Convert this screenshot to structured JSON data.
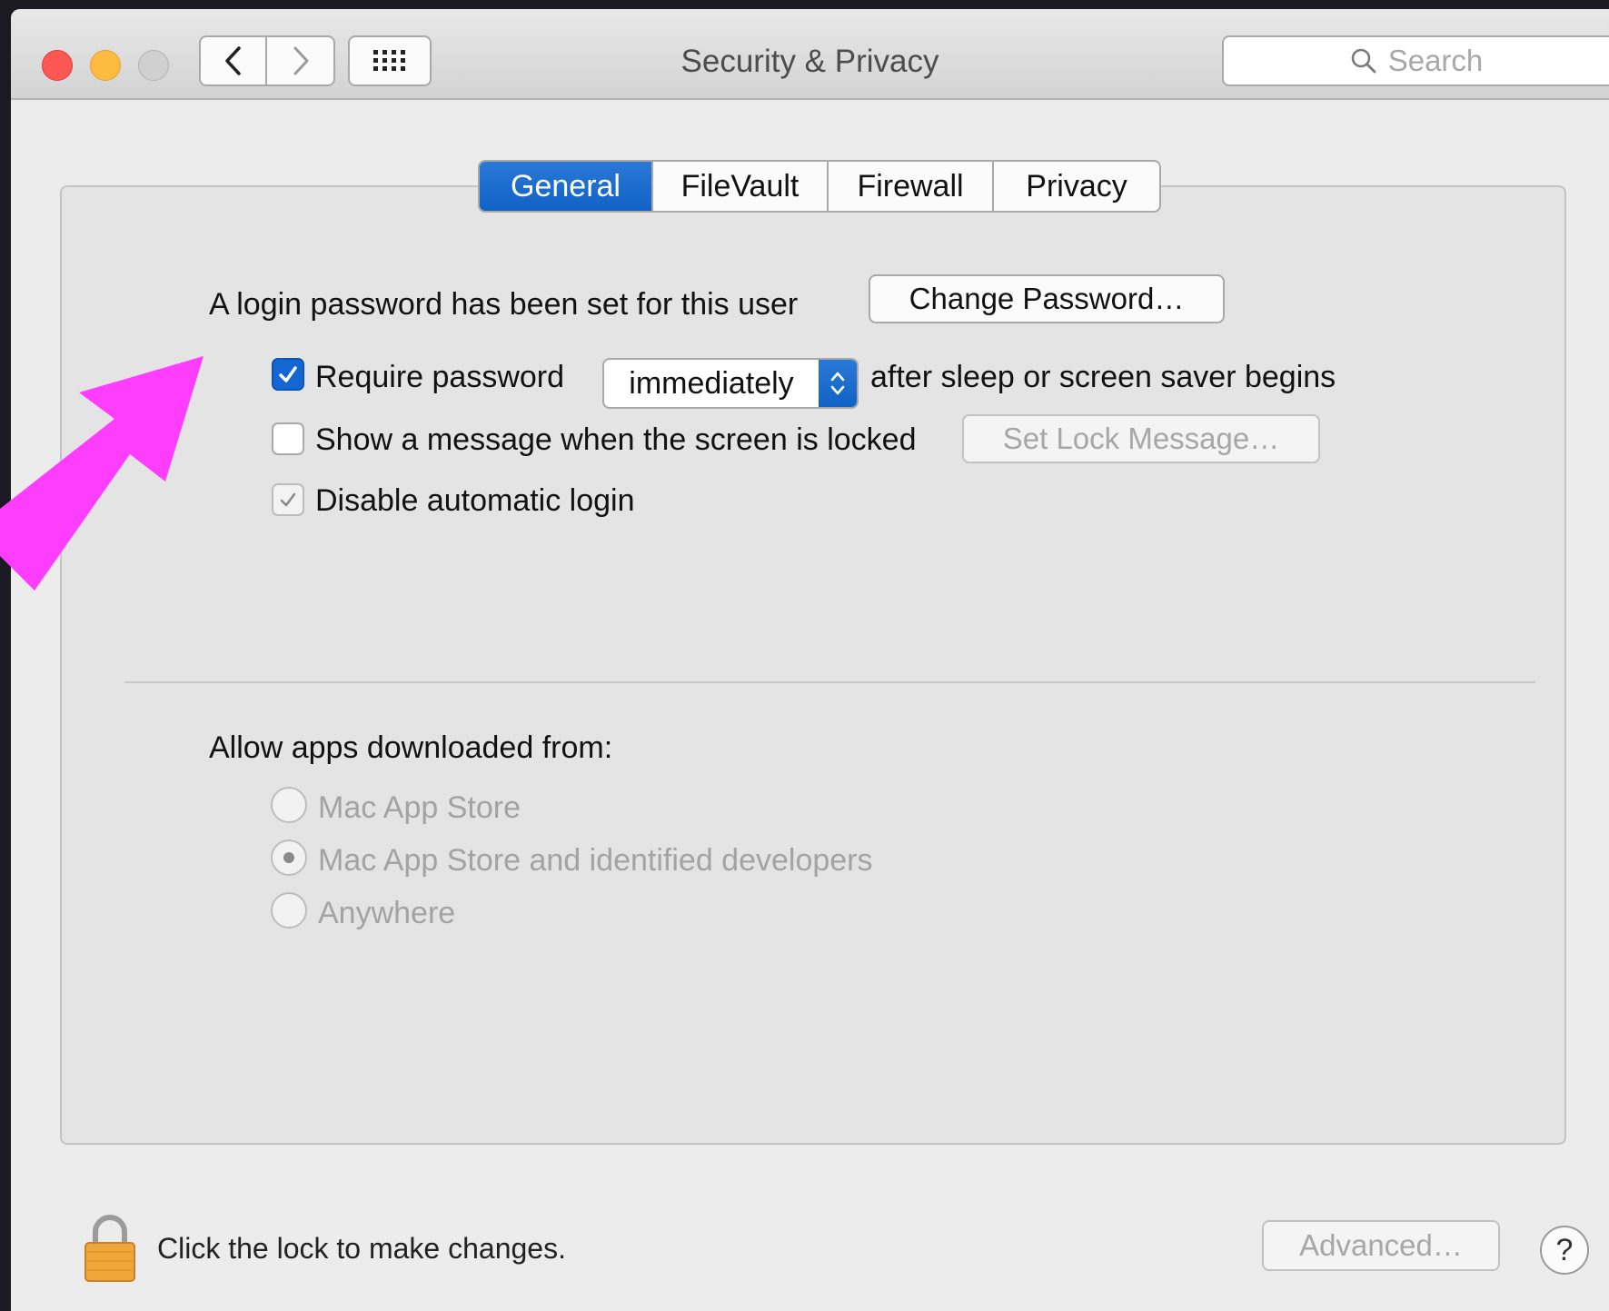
{
  "window": {
    "title": "Security & Privacy"
  },
  "toolbar": {
    "back_icon": "chevron-left-icon",
    "forward_icon": "chevron-right-icon",
    "grid_icon": "grid-icon",
    "search_placeholder": "Search"
  },
  "tabs": [
    {
      "label": "General",
      "active": true
    },
    {
      "label": "FileVault",
      "active": false
    },
    {
      "label": "Firewall",
      "active": false
    },
    {
      "label": "Privacy",
      "active": false
    }
  ],
  "general": {
    "login_password_text": "A login password has been set for this user",
    "change_password_label": "Change Password…",
    "require_password": {
      "label": "Require password",
      "checked": true
    },
    "require_password_delay": "immediately",
    "after_sleep_text": "after sleep or screen saver begins",
    "show_message": {
      "label": "Show a message when the screen is locked",
      "checked": false
    },
    "set_lock_message_label": "Set Lock Message…",
    "disable_auto_login": {
      "label": "Disable automatic login",
      "checked": true,
      "enabled": false
    }
  },
  "allow_apps": {
    "heading": "Allow apps downloaded from:",
    "options": [
      {
        "label": "Mac App Store",
        "selected": false
      },
      {
        "label": "Mac App Store and identified developers",
        "selected": true
      },
      {
        "label": "Anywhere",
        "selected": false
      }
    ]
  },
  "footer": {
    "lock_text": "Click the lock to make changes.",
    "advanced_label": "Advanced…",
    "help_label": "?"
  },
  "colors": {
    "accent": "#1466d2",
    "annotation_arrow": "#ff3dff",
    "close": "#fc5753",
    "minimize": "#fdbc40"
  }
}
